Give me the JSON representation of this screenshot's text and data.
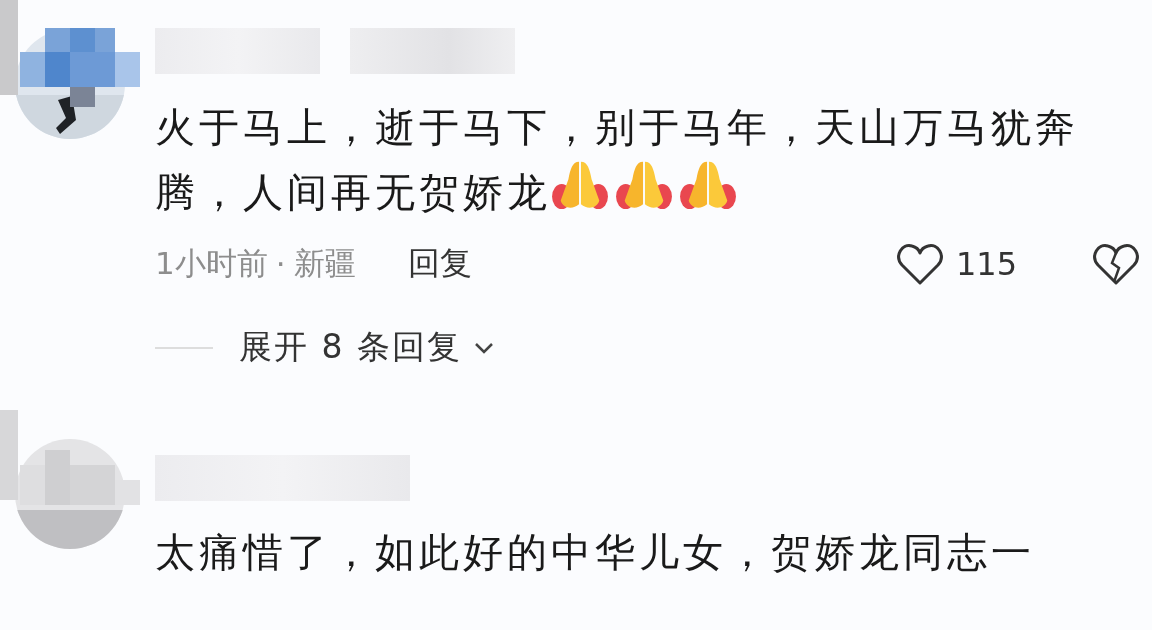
{
  "comments": [
    {
      "text": "火于马上，逝于马下，别于马年，天山万马犹奔腾，人间再无贺娇龙",
      "emojis": [
        {
          "kind": "praying-hands"
        },
        {
          "kind": "praying-hands"
        },
        {
          "kind": "praying-hands"
        }
      ],
      "time": "1小时前",
      "separator": "·",
      "location": "新疆",
      "reply_label": "回复",
      "likes": "115",
      "liked": false,
      "expand_label": "展开 8 条回复"
    },
    {
      "text": "太痛惜了，如此好的中华儿女，贺娇龙同志一"
    }
  ]
}
